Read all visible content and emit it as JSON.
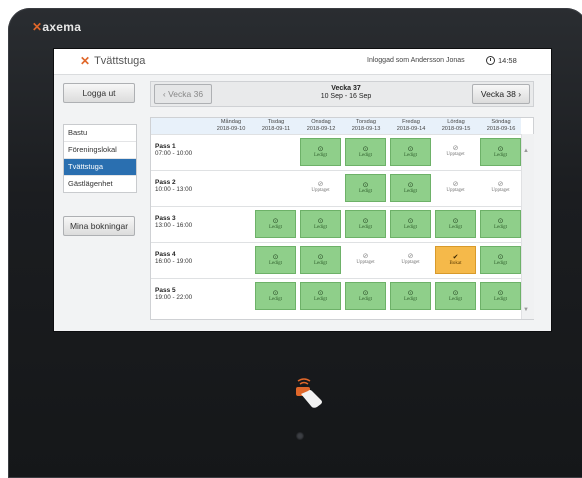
{
  "device": {
    "brand": "axema"
  },
  "header": {
    "app_title": "Tvättstuga",
    "login_status": "Inloggad som Andersson Jonas",
    "time": "14:58"
  },
  "sidebar": {
    "logout_label": "Logga ut",
    "items": [
      {
        "label": "Bastu",
        "active": false
      },
      {
        "label": "Föreningslokal",
        "active": false
      },
      {
        "label": "Tvättstuga",
        "active": true
      },
      {
        "label": "Gästlägenhet",
        "active": false
      }
    ],
    "my_bookings_label": "Mina bokningar"
  },
  "week_nav": {
    "prev_label": "Vecka 36",
    "title": "Vecka 37",
    "range": "10 Sep - 16 Sep",
    "next_label": "Vecka 38"
  },
  "schedule": {
    "days": [
      {
        "name": "Måndag",
        "date": "2018-09-10"
      },
      {
        "name": "Tisdag",
        "date": "2018-09-11"
      },
      {
        "name": "Onsdag",
        "date": "2018-09-12"
      },
      {
        "name": "Torsdag",
        "date": "2018-09-13"
      },
      {
        "name": "Fredag",
        "date": "2018-09-14"
      },
      {
        "name": "Lördag",
        "date": "2018-09-15"
      },
      {
        "name": "Söndag",
        "date": "2018-09-16"
      }
    ],
    "status_labels": {
      "free": "Ledigt",
      "busy": "Upptaget",
      "booked": "Bokat"
    },
    "passes": [
      {
        "name": "Pass 1",
        "time": "07:00 - 10:00",
        "slots": [
          "none",
          "none",
          "free",
          "free",
          "free",
          "busy",
          "free"
        ]
      },
      {
        "name": "Pass 2",
        "time": "10:00 - 13:00",
        "slots": [
          "none",
          "none",
          "busy",
          "free",
          "free",
          "busy",
          "busy"
        ]
      },
      {
        "name": "Pass 3",
        "time": "13:00 - 16:00",
        "slots": [
          "none",
          "free",
          "free",
          "free",
          "free",
          "free",
          "free"
        ]
      },
      {
        "name": "Pass 4",
        "time": "16:00 - 19:00",
        "slots": [
          "none",
          "free",
          "free",
          "busy",
          "busy",
          "booked",
          "free"
        ]
      },
      {
        "name": "Pass 5",
        "time": "19:00 - 22:00",
        "slots": [
          "none",
          "free",
          "free",
          "free",
          "free",
          "free",
          "free"
        ]
      }
    ]
  },
  "colors": {
    "free": "#8fcf8a",
    "booked": "#f5b94a",
    "active_nav": "#2a6fb0",
    "brand_accent": "#e0672a"
  }
}
